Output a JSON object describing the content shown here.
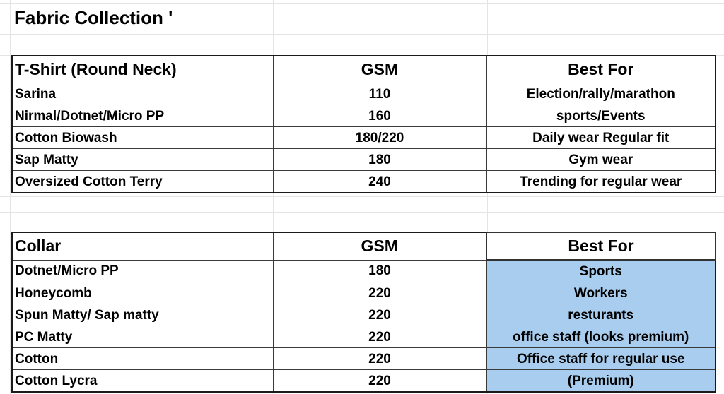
{
  "title": "Fabric Collection '",
  "tshirt_table": {
    "header": {
      "name": "T-Shirt (Round Neck)",
      "gsm": "GSM",
      "best_for": "Best For"
    },
    "rows": [
      {
        "name": "Sarina",
        "gsm": "110",
        "best_for": "Election/rally/marathon"
      },
      {
        "name": "Nirmal/Dotnet/Micro PP",
        "gsm": "160",
        "best_for": "sports/Events"
      },
      {
        "name": "Cotton Biowash",
        "gsm": "180/220",
        "best_for": "Daily wear Regular fit"
      },
      {
        "name": "Sap Matty",
        "gsm": "180",
        "best_for": "Gym wear"
      },
      {
        "name": "Oversized Cotton Terry",
        "gsm": "240",
        "best_for": "Trending for regular wear"
      }
    ]
  },
  "collar_table": {
    "header": {
      "name": "Collar",
      "gsm": "GSM",
      "best_for": "Best For"
    },
    "highlight_color": "#a8cdee",
    "rows": [
      {
        "name": "Dotnet/Micro PP",
        "gsm": "180",
        "best_for": "Sports"
      },
      {
        "name": "Honeycomb",
        "gsm": "220",
        "best_for": "Workers"
      },
      {
        "name": "Spun Matty/ Sap matty",
        "gsm": "220",
        "best_for": "resturants"
      },
      {
        "name": "PC Matty",
        "gsm": "220",
        "best_for": "office staff (looks premium)"
      },
      {
        "name": "Cotton",
        "gsm": "220",
        "best_for": "Office staff for regular use"
      },
      {
        "name": "Cotton Lycra",
        "gsm": "220",
        "best_for": "(Premium)"
      }
    ]
  }
}
